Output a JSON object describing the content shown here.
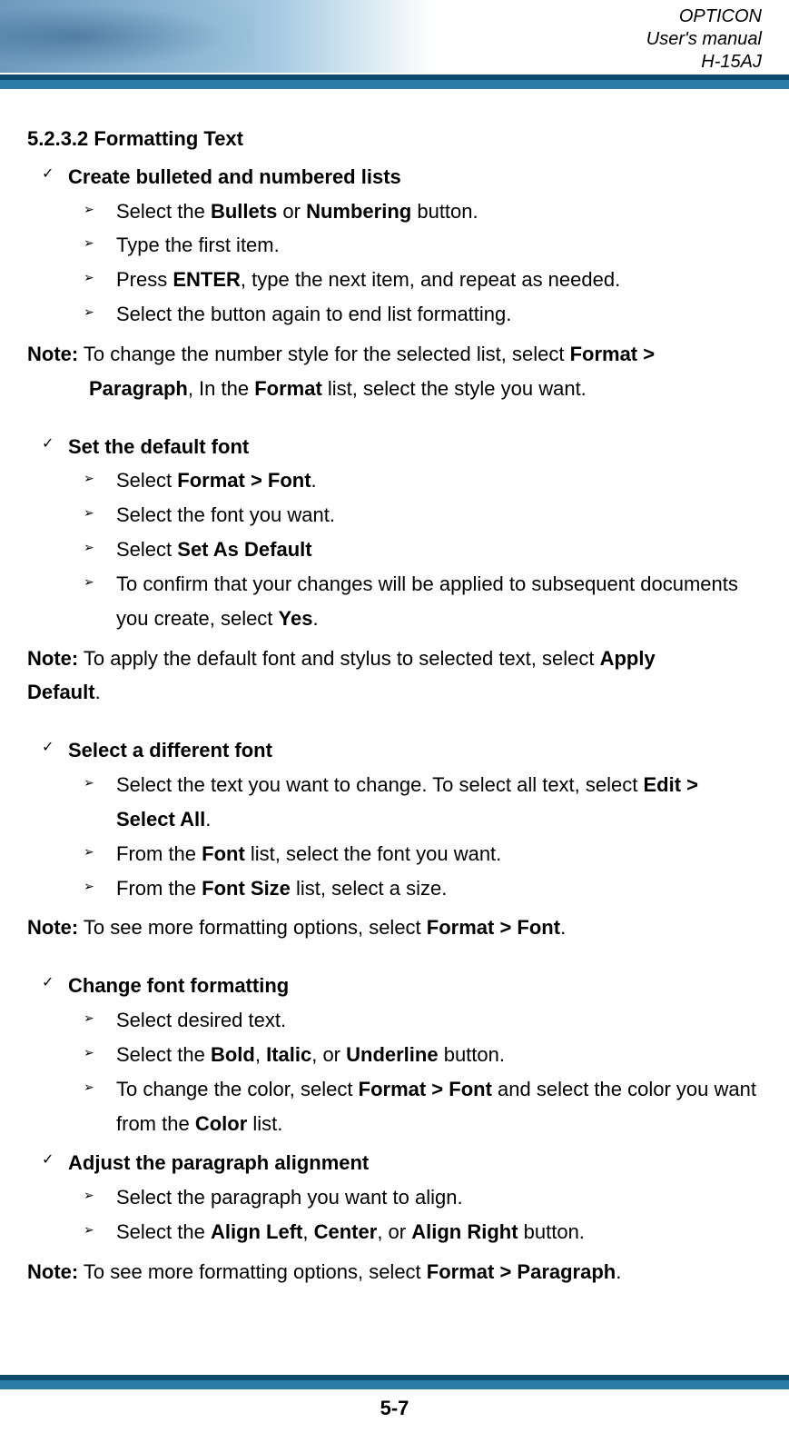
{
  "header": {
    "line1": "OPTICON",
    "line2": "User's manual",
    "line3": "H-15AJ"
  },
  "section": {
    "number": "5.2.3.2",
    "title": "Formatting Text"
  },
  "blocks": [
    {
      "heading": "Create bulleted and numbered lists",
      "items": [
        {
          "pre": "Select the ",
          "b1": "Bullets",
          "mid": " or ",
          "b2": "Numbering",
          "post": " button."
        },
        {
          "pre": "Type the first item."
        },
        {
          "pre": "Press ",
          "b1": "ENTER",
          "post": ", type the next item, and repeat as needed."
        },
        {
          "pre": "Select the button again to end list formatting."
        }
      ],
      "note": {
        "label": "Note:",
        "l1a": " To change the number style for the selected list, select ",
        "l1b": "Format >",
        "l2a": "Paragraph",
        "l2b": ", In the ",
        "l2c": "Format",
        "l2d": " list, select the style you want."
      }
    },
    {
      "heading": "Set the default font",
      "items": [
        {
          "pre": "Select ",
          "b1": "Format > Font",
          "post": "."
        },
        {
          "pre": "Select the font you want."
        },
        {
          "pre": "Select ",
          "b1": "Set As Default"
        },
        {
          "pre": "To confirm that your changes will be applied to subsequent documents you create, select ",
          "b1": "Yes",
          "post": "."
        }
      ],
      "note": {
        "label": "Note:",
        "l1a": " To apply the default font and stylus to selected text, select ",
        "l1b": "Apply",
        "l2a": "Default",
        "l2b": "."
      }
    },
    {
      "heading": "Select a different font",
      "items": [
        {
          "pre": "Select the text you want to change. To select all text, select ",
          "b1": "Edit > Select All",
          "post": "."
        },
        {
          "pre": "From the ",
          "b1": "Font",
          "post": " list, select the font you want."
        },
        {
          "pre": "From the ",
          "b1": "Font Size",
          "post": " list, select a size."
        }
      ],
      "note": {
        "label": "Note:",
        "l1a": " To see more formatting options, select ",
        "l1b": "Format > Font",
        "l1c": "."
      }
    },
    {
      "heading": "Change font formatting",
      "items": [
        {
          "pre": "Select desired text."
        },
        {
          "pre": "Select the ",
          "b1": "Bold",
          "mid1": ", ",
          "b2": "Italic",
          "mid2": ", or ",
          "b3": "Underline",
          "post": " button."
        },
        {
          "pre": "To change the color, select ",
          "b1": "Format > Font",
          "mid1": " and select the color you want from the ",
          "b2": "Color",
          "post": " list."
        }
      ]
    },
    {
      "heading": "Adjust the paragraph alignment",
      "items": [
        {
          "pre": "Select the paragraph you want to align."
        },
        {
          "pre": "Select the ",
          "b1": "Align Left",
          "mid1": ", ",
          "b2": "Center",
          "mid2": ", or ",
          "b3": "Align Right",
          "post": " button."
        }
      ],
      "note": {
        "label": "Note:",
        "l1a": " To see more formatting options, select ",
        "l1b": "Format > Paragraph",
        "l1c": "."
      }
    }
  ],
  "page_number": "5-7"
}
